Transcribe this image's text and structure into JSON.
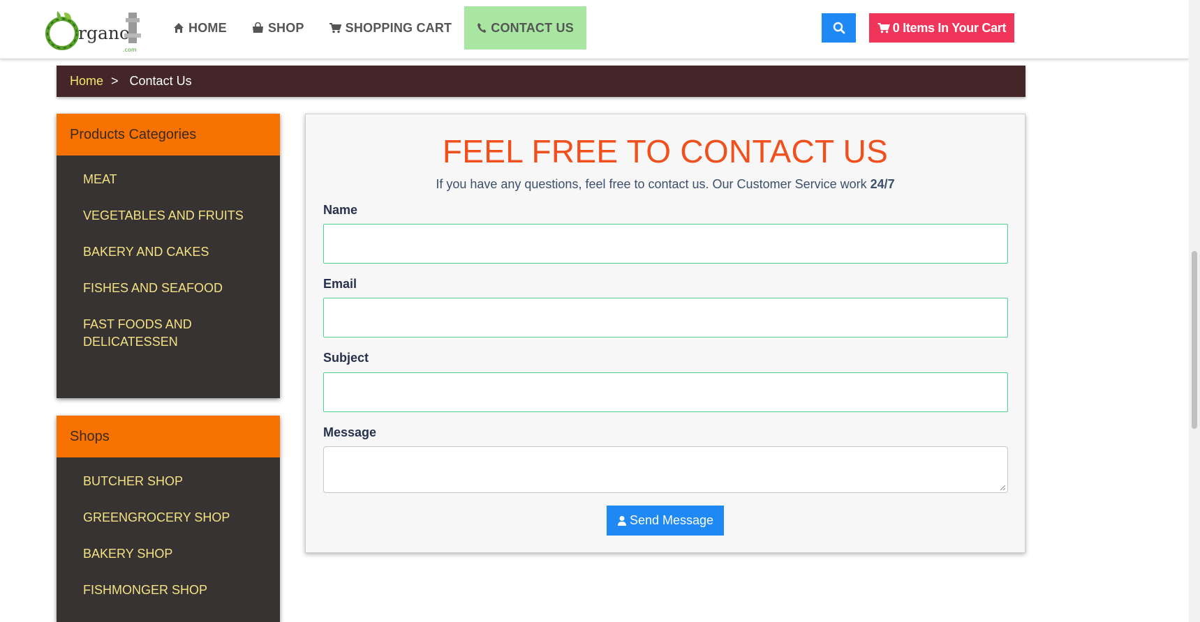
{
  "header": {
    "logo_text": "rgano",
    "logo_suffix": ".com",
    "nav": [
      {
        "label": "HOME",
        "icon": "home-icon"
      },
      {
        "label": "SHOP",
        "icon": "shopping-bag-icon"
      },
      {
        "label": "SHOPPING CART",
        "icon": "cart-icon"
      },
      {
        "label": "CONTACT US",
        "icon": "phone-icon",
        "active": true
      }
    ],
    "search_icon": "search-icon",
    "cart_button": "0 Items In Your Cart"
  },
  "breadcrumb": {
    "home": "Home",
    "separator": ">",
    "current": "Contact Us"
  },
  "sidebar": {
    "categories": {
      "title": "Products Categories",
      "items": [
        "MEAT",
        "VEGETABLES AND FRUITS",
        "BAKERY AND CAKES",
        "FISHES AND SEAFOOD",
        "FAST FOODS AND DELICATESSEN"
      ]
    },
    "shops": {
      "title": "Shops",
      "items": [
        "BUTCHER SHOP",
        "GREENGROCERY SHOP",
        "BAKERY SHOP",
        "FISHMONGER SHOP"
      ]
    }
  },
  "contact": {
    "title": "FEEL FREE TO CONTACT US",
    "subtitle": "If you have any questions, feel free to contact us. Our Customer Service work",
    "subtitle_bold": "24/7",
    "fields": {
      "name": {
        "label": "Name",
        "value": ""
      },
      "email": {
        "label": "Email",
        "value": ""
      },
      "subject": {
        "label": "Subject",
        "value": ""
      },
      "message": {
        "label": "Message",
        "value": ""
      }
    },
    "send_button": "Send Message"
  },
  "colors": {
    "accent_orange": "#f77200",
    "title_orange": "#f0501d",
    "link_yellow": "#f4e283",
    "primary_blue": "#1e88f5",
    "cart_red": "#f0355a",
    "active_nav_green": "#a8e6a1",
    "breadcrumb_bg": "#442628",
    "sidebar_bg": "#373333"
  }
}
